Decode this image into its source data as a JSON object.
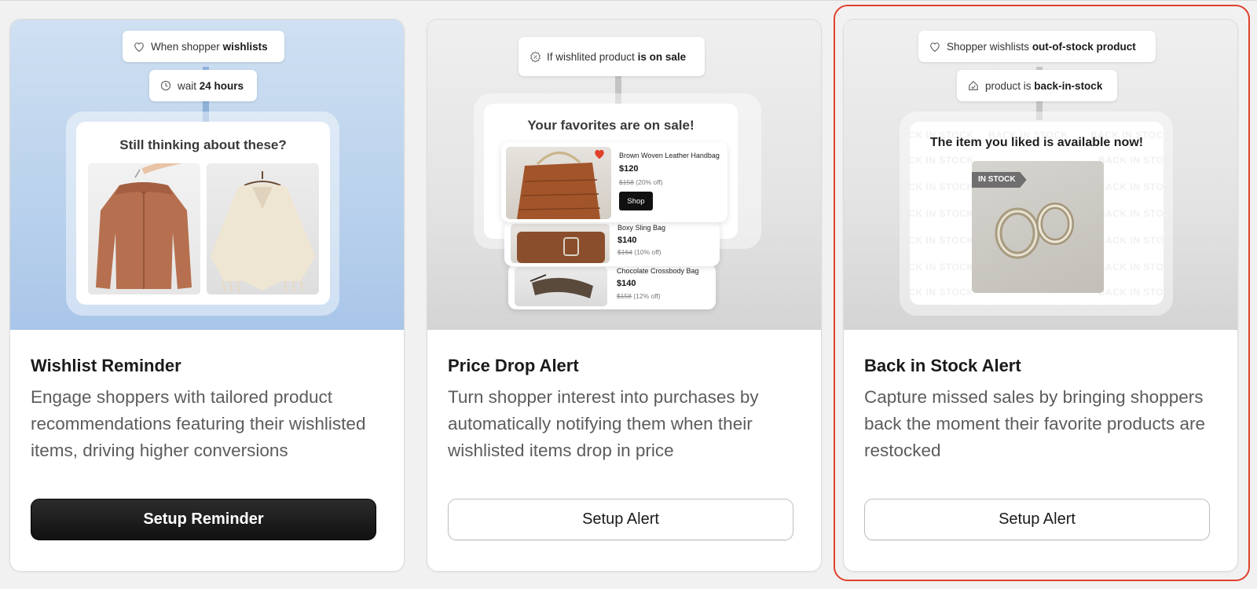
{
  "cards": [
    {
      "title": "Wishlist Reminder",
      "description": "Engage shoppers with tailored product recommendations featuring their wishlisted items, driving higher conversions",
      "button": "Setup Reminder",
      "hero": {
        "step1_prefix": "When shopper",
        "step1_bold": "wishlists",
        "step2_prefix": "wait",
        "step2_bold": "24 hours",
        "email_title": "Still thinking about these?"
      }
    },
    {
      "title": "Price Drop Alert",
      "description": "Turn shopper interest into purchases by automatically notifying them when their wishlisted items drop in price",
      "button": "Setup Alert",
      "hero": {
        "step1_prefix": "If wishlited product",
        "step1_bold": "is on sale",
        "email_title": "Your favorites are on sale!",
        "products": [
          {
            "name": "Brown Woven Leather Handbag",
            "price": "$120",
            "old_price": "$158",
            "discount": "(20% off)"
          },
          {
            "name": "Boxy Sling Bag",
            "price": "$140",
            "old_price": "$164",
            "discount": "(10% off)"
          },
          {
            "name": "Chocolate Crossbody Bag",
            "price": "$140",
            "old_price": "$158",
            "discount": "(12% off)"
          }
        ],
        "shop_label": "Shop"
      }
    },
    {
      "title": "Back in Stock Alert",
      "description": "Capture missed sales by bringing shoppers back the moment their favorite products are restocked",
      "button": "Setup Alert",
      "hero": {
        "step1_prefix": "Shopper wishlists",
        "step1_bold": "out-of-stock product",
        "step2_prefix": "product is",
        "step2_bold": "back-in-stock",
        "email_title": "The item you liked is available now!",
        "badge": "IN STOCK",
        "watermark": "BACK IN STOCK"
      }
    }
  ],
  "selected_card_index": 2,
  "colors": {
    "selected_outline": "#e0412b",
    "heart": "#e0412b",
    "dark_button": "#111111"
  }
}
